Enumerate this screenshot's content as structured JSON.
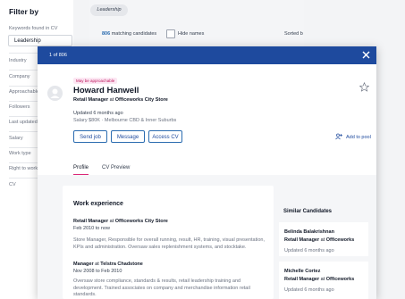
{
  "filters": {
    "title": "Filter by",
    "keywords_label": "Keywords found in CV",
    "keywords_value": "Leadership",
    "facets": [
      "Industry",
      "Company",
      "Approachable",
      "Followers",
      "Last updated",
      "Salary",
      "Work type",
      "Right to work",
      "CV"
    ]
  },
  "results": {
    "chip_label": "Leadership",
    "count": "806",
    "matching_label": "matching candidates",
    "hide_names_label": "Hide names",
    "sorted_label": "Sorted b"
  },
  "modal": {
    "counter": "1 of 806",
    "approachable_badge": "May be approachable",
    "name": "Howard Hanwell",
    "role_title": "Retail Manager",
    "role_at": "at",
    "role_company": "Officeworks City Store",
    "updated": "Updated 6 months ago",
    "salary": "Salary $80K",
    "location": "Melbourne CBD & Inner Suburbs",
    "buttons": {
      "send_job": "Send job",
      "message": "Message",
      "access_cv": "Access CV"
    },
    "add_to_pool": "Add to pool",
    "tabs": [
      "Profile",
      "CV Preview"
    ],
    "work_experience_title": "Work experience",
    "jobs": [
      {
        "title": "Retail Manager",
        "at": "at",
        "company": "Officeworks City Store",
        "dates": "Feb 2010 to now",
        "description": "Store Manager, Responsible for overall running, result, HR, training, visual presentation, KPIs and administration. Oversaw sales replenishment systems, and stocktake."
      },
      {
        "title": "Manager",
        "at": "at",
        "company": "Telstra Chadstone",
        "dates": "Nov 2008 to Feb 2010",
        "description": "Oversaw store compliance, standards & results, retail leadership training and development. Trained associates on company and merchandise information retail standards."
      }
    ],
    "similar_title": "Similar Candidates",
    "similar": [
      {
        "name": "Belinda Balakrishnan",
        "role": "Retail Manager",
        "at": "at",
        "company": "Officeworks",
        "updated": "Updated 6 months ago"
      },
      {
        "name": "Michelle Cortez",
        "role": "Retail Manager",
        "at": "at",
        "company": "Officeworks",
        "updated": "Updated 6 months ago"
      }
    ]
  },
  "colors": {
    "header": "#1e4a9e",
    "accent": "#db2777",
    "link": "#2b6cb0"
  },
  "icons": [
    "close-icon",
    "star-icon",
    "avatar-icon",
    "add-to-pool-icon"
  ]
}
